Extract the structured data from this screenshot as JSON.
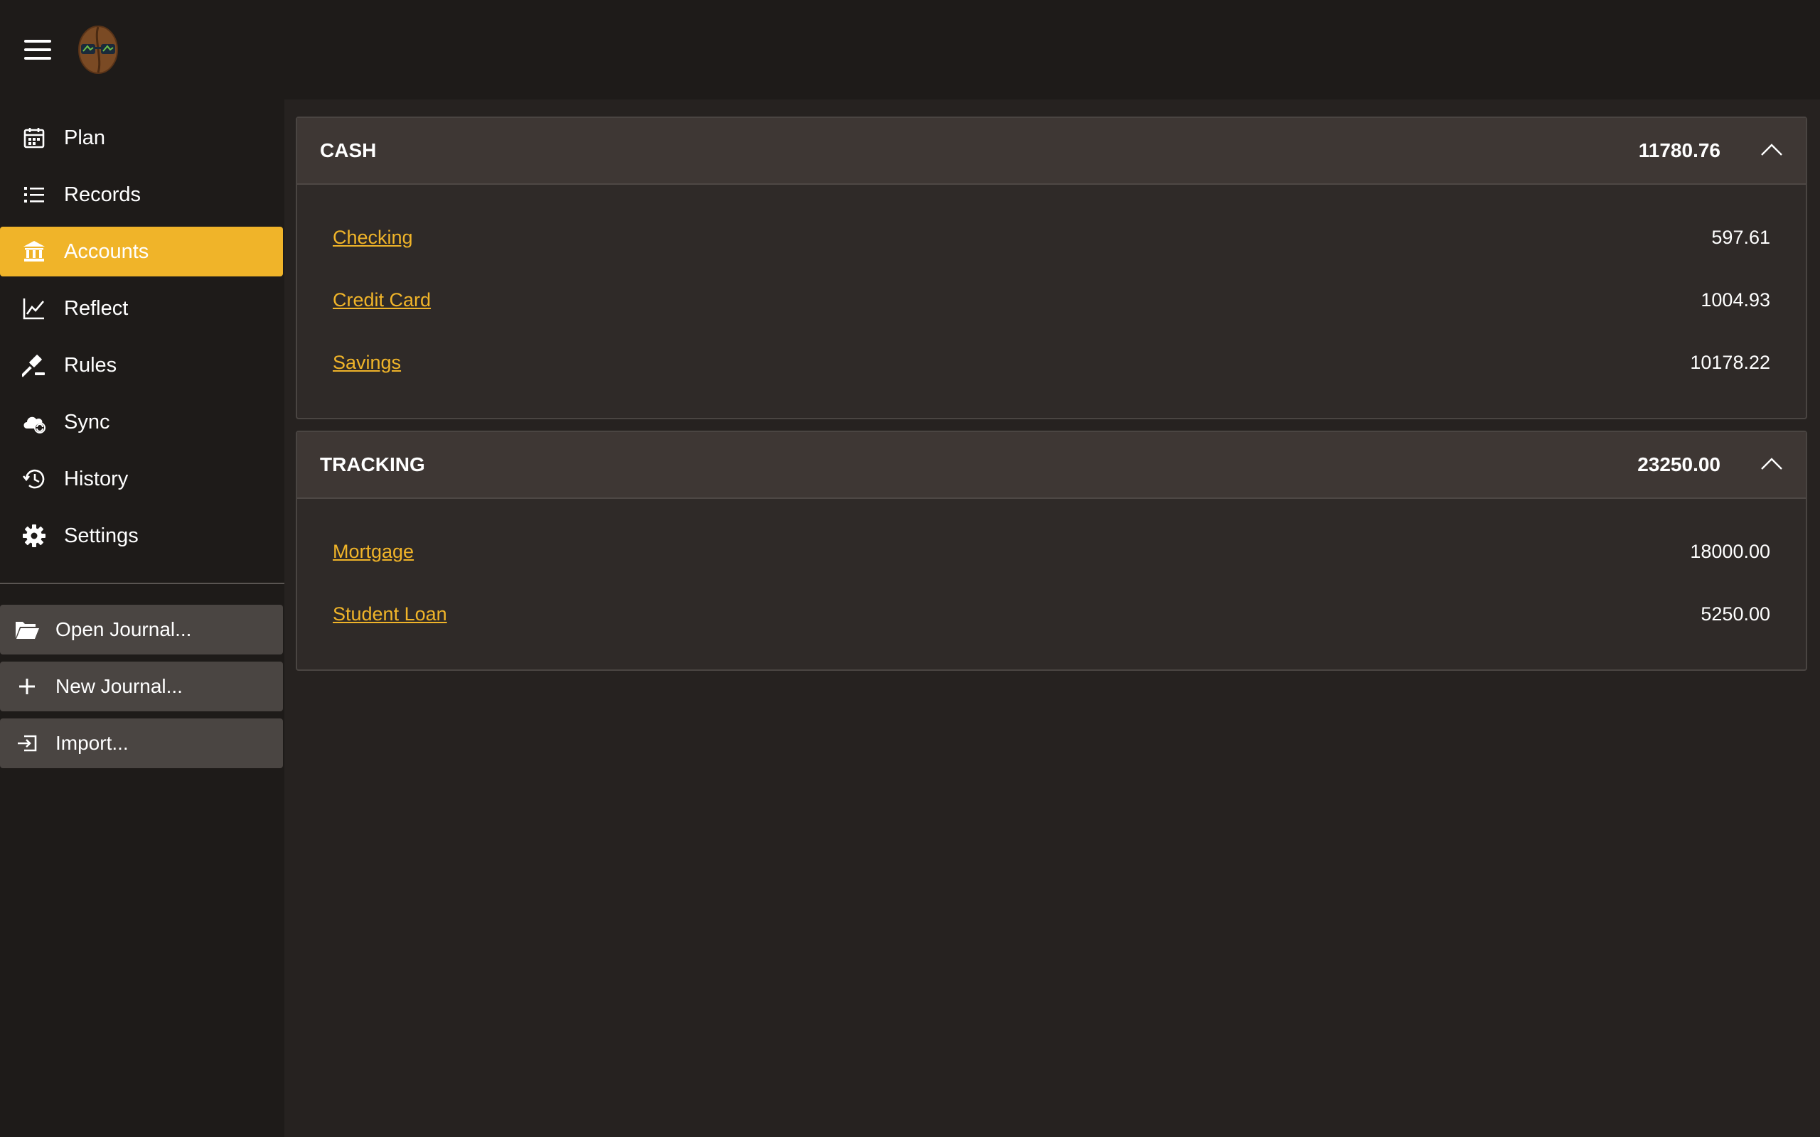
{
  "nav": {
    "items": [
      {
        "label": "Plan",
        "icon": "calendar-icon"
      },
      {
        "label": "Records",
        "icon": "list-icon"
      },
      {
        "label": "Accounts",
        "icon": "bank-icon",
        "active": true
      },
      {
        "label": "Reflect",
        "icon": "line-chart-icon"
      },
      {
        "label": "Rules",
        "icon": "gavel-icon"
      },
      {
        "label": "Sync",
        "icon": "cloud-sync-icon"
      },
      {
        "label": "History",
        "icon": "history-icon"
      },
      {
        "label": "Settings",
        "icon": "gear-icon"
      }
    ]
  },
  "actions": {
    "open_journal": "Open Journal...",
    "new_journal": "New Journal...",
    "import": "Import..."
  },
  "groups": [
    {
      "title": "CASH",
      "total": "11780.76",
      "accounts": [
        {
          "name": "Checking",
          "balance": "597.61"
        },
        {
          "name": "Credit Card",
          "balance": "1004.93"
        },
        {
          "name": "Savings",
          "balance": "10178.22"
        }
      ]
    },
    {
      "title": "TRACKING",
      "total": "23250.00",
      "accounts": [
        {
          "name": "Mortgage",
          "balance": "18000.00"
        },
        {
          "name": "Student Loan",
          "balance": "5250.00"
        }
      ]
    }
  ],
  "colors": {
    "accent": "#f0b429",
    "background": "#262220",
    "sidebar": "#1e1b19"
  }
}
